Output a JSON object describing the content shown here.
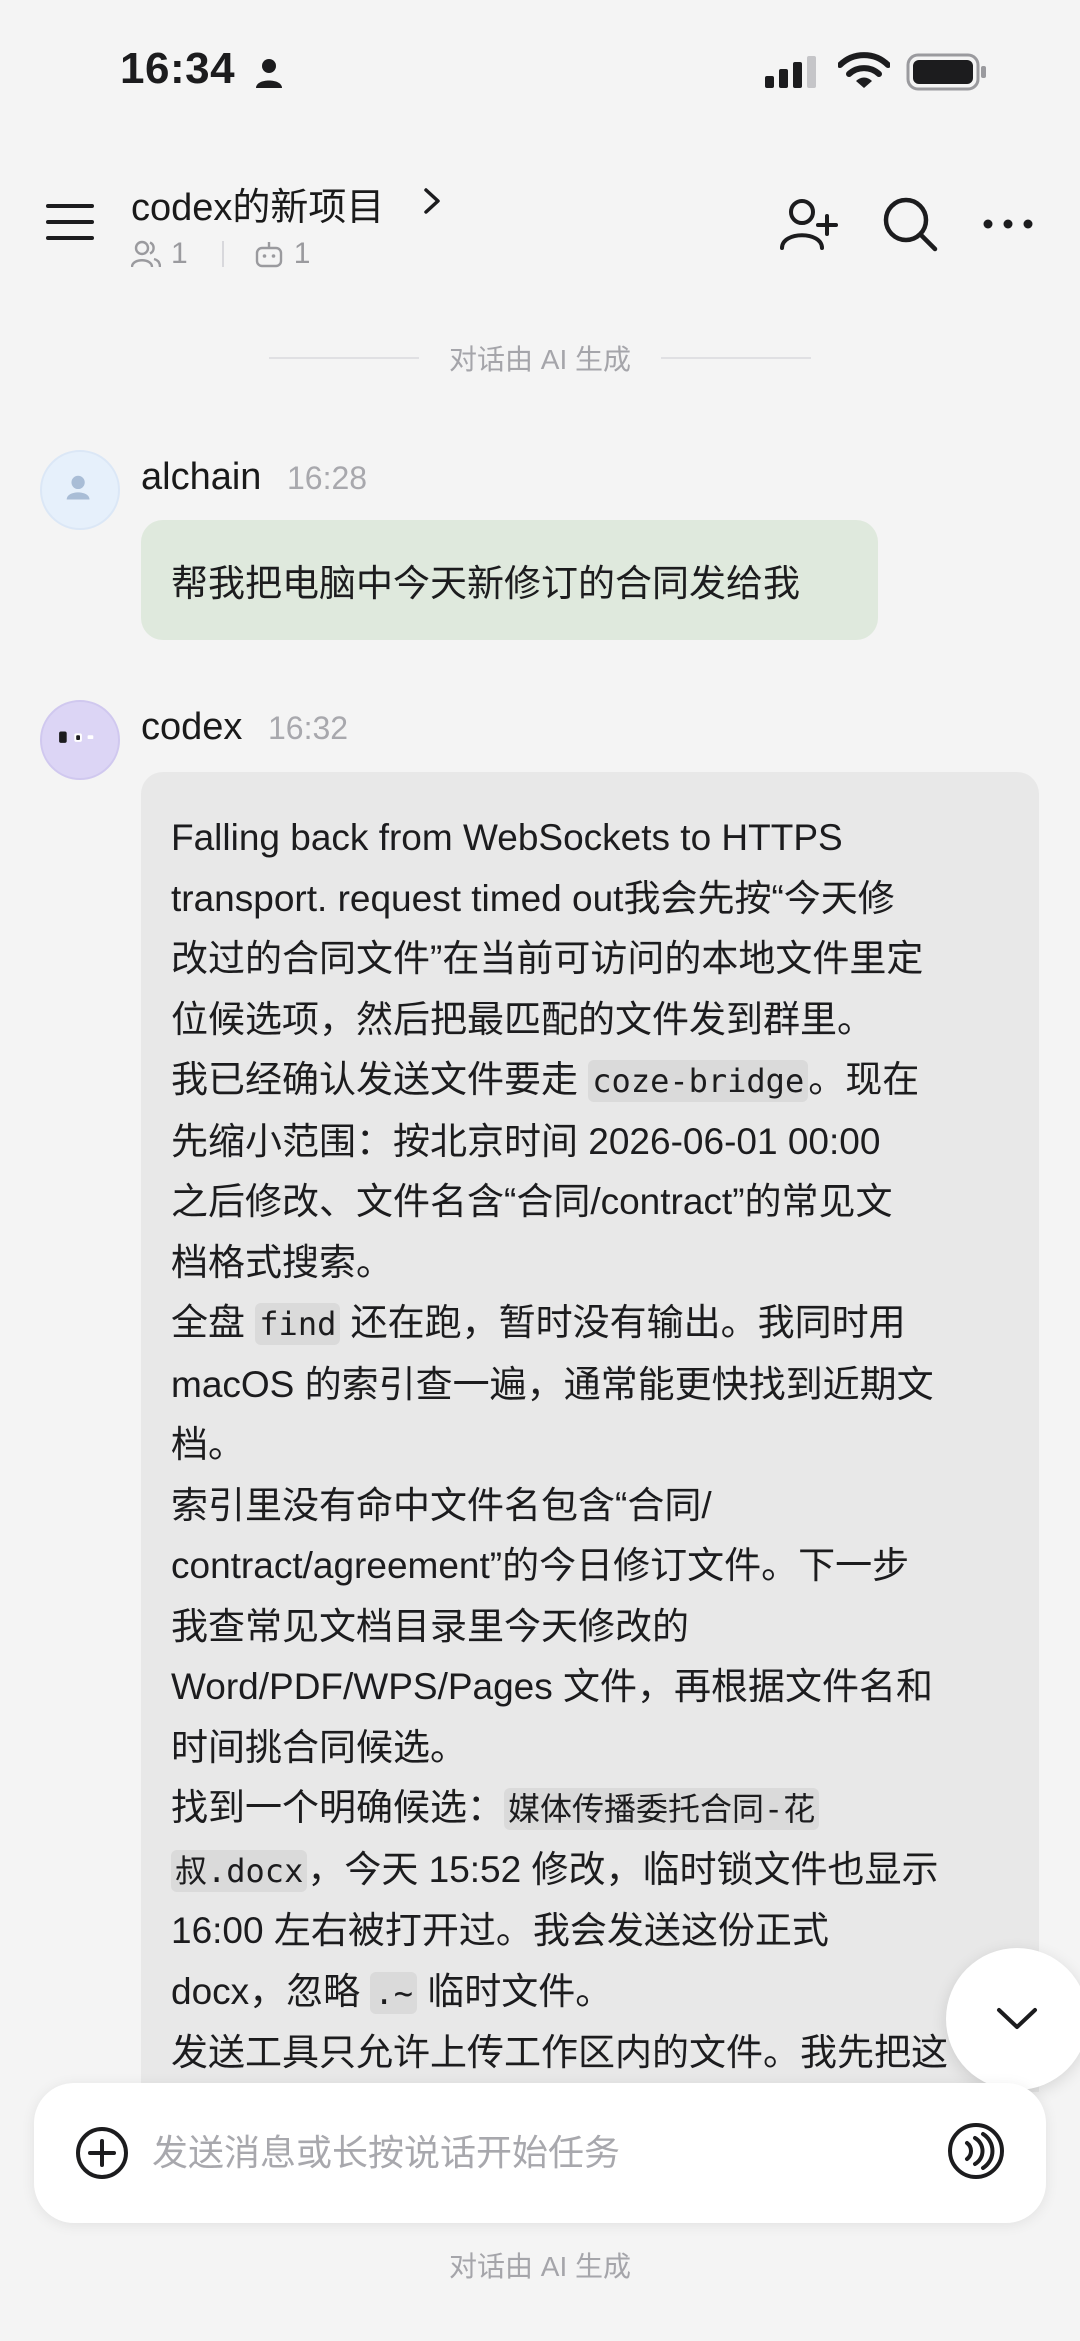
{
  "status_bar": {
    "time": "16:34"
  },
  "header": {
    "title": "codex的新项目",
    "member_count": "1",
    "bot_count": "1"
  },
  "ai_notice": "对话由 AI 生成",
  "messages": [
    {
      "sender": "alchain",
      "time": "16:28",
      "text": "帮我把电脑中今天新修订的合同发给我"
    },
    {
      "sender": "codex",
      "time": "16:32",
      "lines": [
        "Falling back from WebSockets to HTTPS",
        "transport. request timed out我会先按“今天修",
        "改过的合同文件”在当前可访问的本地文件里定",
        "位候选项，然后把最匹配的文件发到群里。",
        "我已经确认发送文件要走 ",
        "coze-bridge",
        "。现在",
        "先缩小范围：按北京时间 2026-06-01 00:00",
        "之后修改、文件名含“合同/contract”的常见文",
        "档格式搜索。",
        "全盘 ",
        "find",
        " 还在跑，暂时没有输出。我同时用",
        "macOS 的索引查一遍，通常能更快找到近期文",
        "档。",
        "索引里没有命中文件名包含“合同/",
        "contract/agreement”的今日修订文件。下一步",
        "我查常见文档目录里今天修改的",
        "Word/PDF/WPS/Pages 文件，再根据文件名和",
        "时间挑合同候选。",
        "找到一个明确候选：",
        "媒体传播委托合同-花",
        "叔.docx",
        "，今天 15:52 修改，临时锁文件也显示",
        "16:00 左右被打开过。我会发送这份正式",
        "docx，忽略 ",
        ".~",
        " 临时文件。",
        "发送工具只允许上传工作区内的文件。我先把这"
      ]
    }
  ],
  "input": {
    "placeholder": "发送消息或长按说话开始任务",
    "value": ""
  },
  "colors": {
    "background": "#f4f4f4",
    "user_bubble": "#dfe9dd",
    "bot_bubble": "#e8e8e8",
    "muted_text": "#a8a8ad"
  },
  "icons": [
    "person-icon",
    "signal-icon",
    "wifi-icon",
    "battery-icon",
    "menu-icon",
    "chevron-right-icon",
    "members-icon",
    "robot-icon",
    "add-member-icon",
    "search-icon",
    "more-icon",
    "user-avatar-icon",
    "bot-avatar-icon",
    "chevron-down-icon",
    "plus-circle-icon",
    "voice-icon"
  ]
}
